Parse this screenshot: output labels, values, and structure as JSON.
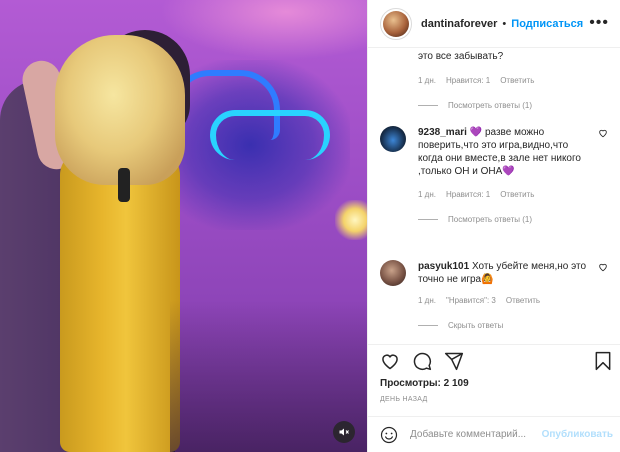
{
  "header": {
    "username": "dantinaforever",
    "separator": "•",
    "follow_label": "Подписаться",
    "more_label": "•••"
  },
  "comments": [
    {
      "text": "это все забывать?",
      "time": "1 дн.",
      "likes": "Нравится: 1",
      "reply": "Ответить",
      "view_replies": "Посмотреть ответы (1)"
    },
    {
      "username": "9238_mari",
      "text": "разве можно поверить,что это игра,видно,что когда они вместе,в зале нет никого ,только ОН и ОНА",
      "emoji_after_name": "💜",
      "emoji_end": "💜",
      "time": "1 дн.",
      "likes": "Нравится: 1",
      "reply": "Ответить",
      "view_replies": "Посмотреть ответы (1)"
    },
    {
      "username": "pasyuk101",
      "text": "Хоть убейте меня,но это точно не игра",
      "emoji_end": "🙆",
      "time": "1 дн.",
      "likes": "\"Нравится\": 3",
      "reply": "Ответить",
      "view_replies": "Скрыть ответы"
    }
  ],
  "actions": {
    "views": "Просмотры: 2 109",
    "posted_ago": "ДЕНЬ НАЗАД"
  },
  "add_comment": {
    "placeholder": "Добавьте комментарий...",
    "publish_label": "Опубликовать"
  },
  "colors": {
    "accent": "#0095f6",
    "publish_disabled": "#b2dffc",
    "muted_text": "#8e8e8e"
  },
  "icons": [
    "heart-icon",
    "comment-icon",
    "share-icon",
    "bookmark-icon",
    "smile-icon",
    "mute-icon"
  ]
}
